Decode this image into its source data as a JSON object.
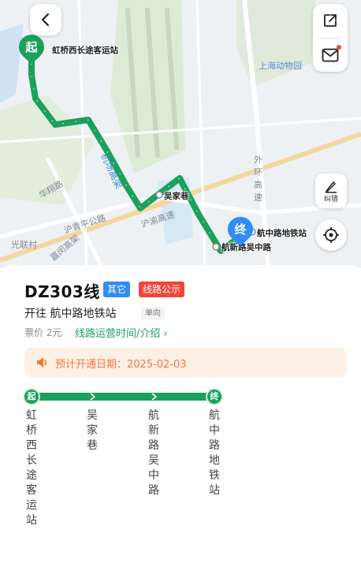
{
  "map": {
    "labels": {
      "hongqiao_terminal": "虹桥西长途客运站",
      "shanghai_zoo": "上海动物园",
      "outer_ring": "外环高速",
      "huaxiang_road": "华翔路",
      "huqing_road": "沪青平公路",
      "huyu_expressway": "沪渝高速",
      "jiaxiang_road": "嘉闵高架",
      "guangli_village": "光联村",
      "wujiaxiang": "吴家巷",
      "hangxin_wuzhong": "航新路吴中路",
      "hangzhong_station": "航中路地铁站",
      "airport_road": "机场高架"
    },
    "start_marker": "起",
    "end_marker": "终",
    "correct_label": "纠错",
    "colors": {
      "route": "#1aa15c",
      "start": "#1aa15c",
      "end": "#2f8df5"
    }
  },
  "line": {
    "name": "DZ303线",
    "tag_type": "其它",
    "tag_notice": "线路公示",
    "direction": "开往 航中路地铁站",
    "oneway": "单向",
    "fare": "票价 2元",
    "hours_link": "线路运营时间/介绍 ›",
    "notice": "预计开通日期：2025-02-03"
  },
  "stops": [
    {
      "marker": "起",
      "name": "虹桥西长途客运站"
    },
    {
      "marker": "",
      "name": "吴家巷"
    },
    {
      "marker": "",
      "name": "航新路吴中路"
    },
    {
      "marker": "终",
      "name": "航中路地铁站"
    }
  ],
  "icons": [
    "back-icon",
    "share-icon",
    "mail-icon",
    "pen-icon",
    "locate-icon",
    "speaker-icon"
  ]
}
